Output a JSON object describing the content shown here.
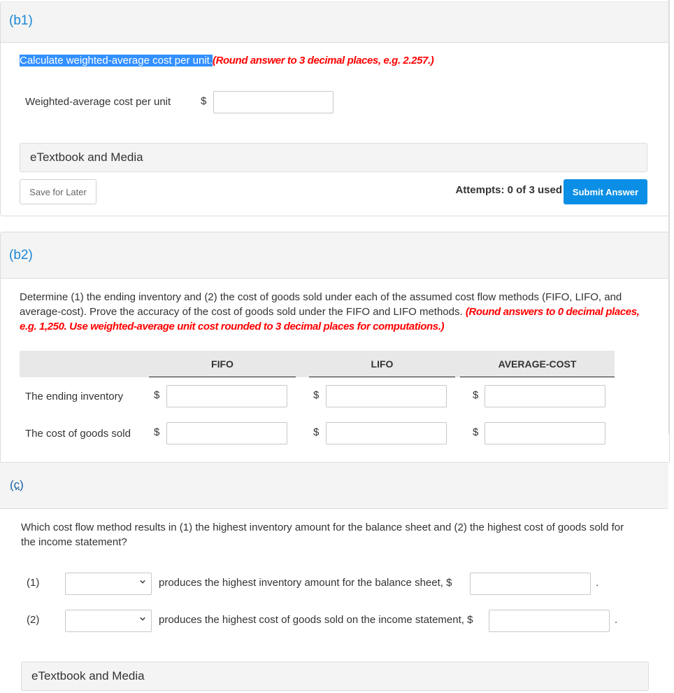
{
  "b1": {
    "part_label": "(b1)",
    "prompt_highlighted": "Calculate weighted-average cost per unit.",
    "prompt_instruction": "(Round answer to 3 decimal places, e.g. 2.257.)",
    "field_label": "Weighted-average cost per unit",
    "currency_symbol": "$",
    "field_value": "",
    "media_label": "eTextbook and Media",
    "save_label": "Save for Later",
    "attempts_text": "Attempts: 0 of 3 used",
    "submit_label": "Submit Answer"
  },
  "b2": {
    "part_label": "(b2)",
    "prompt_line1": "Determine (1) the ending inventory and (2) the cost of goods sold under each of the assumed cost flow methods (FIFO, LIFO, and",
    "prompt_line2_plain": "average-cost). Prove the accuracy of the cost of goods sold under the FIFO and LIFO methods. ",
    "prompt_line2_instruction": "(Round answers to 0 decimal places,",
    "prompt_line3_instruction": "e.g. 1,250. Use weighted-average unit cost rounded to 3 decimal places for computations.)",
    "columns": [
      "FIFO",
      "LIFO",
      "AVERAGE-COST"
    ],
    "currency_symbol": "$",
    "rows": [
      {
        "label": "The ending inventory",
        "values": [
          "",
          "",
          ""
        ]
      },
      {
        "label": "The cost of goods sold",
        "values": [
          "",
          "",
          ""
        ]
      }
    ]
  },
  "c": {
    "part_label": "(c)",
    "question_line1": "Which cost flow method results in (1) the highest inventory amount for the balance sheet and (2) the highest cost of goods sold for",
    "question_line2": "the income statement?",
    "items": [
      {
        "number": "(1)",
        "selected": "",
        "text": "produces the highest inventory amount for the balance sheet, $",
        "amount": "",
        "period": "."
      },
      {
        "number": "(2)",
        "selected": "",
        "text": "produces the highest cost of goods sold on the income statement, $",
        "amount": "",
        "period": "."
      }
    ],
    "media_label": "eTextbook and Media"
  },
  "colors": {
    "part_label": "#1a87d6",
    "instruction_red": "#ff0000",
    "submit_button": "#0a8ee6",
    "selection_highlight": "#3390ff"
  }
}
